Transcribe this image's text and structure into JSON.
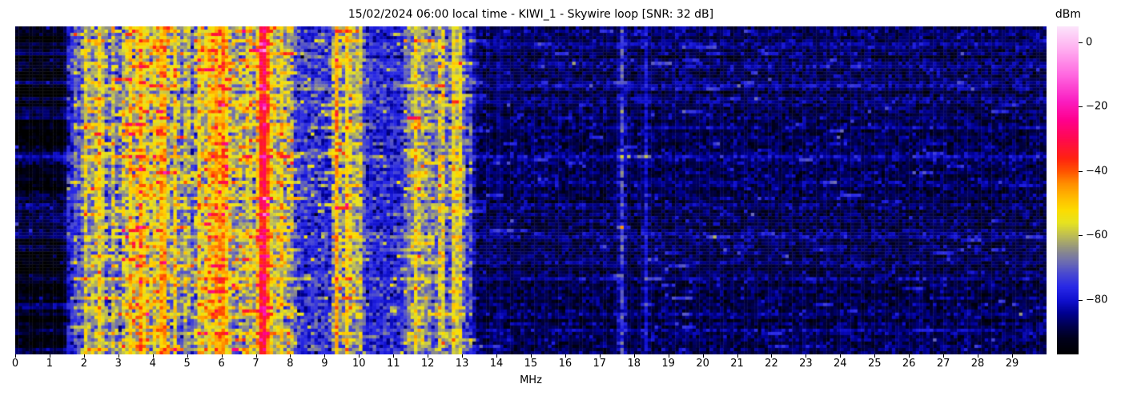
{
  "chart_data": {
    "type": "heatmap",
    "title": "15/02/2024 06:00 local time - KIWI_1 - Skywire loop [SNR: 32 dB]",
    "xlabel": "MHz",
    "x_range": [
      0,
      30
    ],
    "x_ticks": [
      0,
      1,
      2,
      3,
      4,
      5,
      6,
      7,
      8,
      9,
      10,
      11,
      12,
      13,
      14,
      15,
      16,
      17,
      18,
      19,
      20,
      21,
      22,
      23,
      24,
      25,
      26,
      27,
      28,
      29
    ],
    "x_tick_labels": [
      "0",
      "1",
      "2",
      "3",
      "4",
      "5",
      "6",
      "7",
      "8",
      "9",
      "10",
      "11",
      "12",
      "13",
      "14",
      "15",
      "16",
      "17",
      "18",
      "19",
      "20",
      "21",
      "22",
      "23",
      "24",
      "25",
      "26",
      "27",
      "28",
      "29"
    ],
    "y_axis_labels_shown": false,
    "colorbar": {
      "label": "dBm",
      "tick_values": [
        0,
        -20,
        -40,
        -60,
        -80
      ],
      "tick_labels": [
        "0",
        "−20",
        "−40",
        "−60",
        "−80"
      ],
      "value_range": [
        -97,
        5
      ],
      "colormap_stops": [
        [
          0.0,
          "#000000"
        ],
        [
          0.05,
          "#00001c"
        ],
        [
          0.088,
          "#00004e"
        ],
        [
          0.127,
          "#000090"
        ],
        [
          0.167,
          "#1010cf"
        ],
        [
          0.206,
          "#2828e6"
        ],
        [
          0.245,
          "#4747d2"
        ],
        [
          0.284,
          "#6e6eb0"
        ],
        [
          0.324,
          "#929282"
        ],
        [
          0.363,
          "#bdbd55"
        ],
        [
          0.402,
          "#e6e320"
        ],
        [
          0.441,
          "#fcdc00"
        ],
        [
          0.48,
          "#ffba00"
        ],
        [
          0.52,
          "#ff9000"
        ],
        [
          0.559,
          "#ff5300"
        ],
        [
          0.598,
          "#ff2310"
        ],
        [
          0.657,
          "#ff0a4e"
        ],
        [
          0.716,
          "#ff008e"
        ],
        [
          0.775,
          "#fa1fc2"
        ],
        [
          0.853,
          "#ff68e0"
        ],
        [
          0.931,
          "#ffaef0"
        ],
        [
          1.0,
          "#fce4fb"
        ]
      ]
    },
    "grid": {
      "cols": 300,
      "rows": 102
    },
    "seed": 12345,
    "burst_count": 900,
    "noise_bands": [
      [
        0.0,
        1.55,
        -93,
        2.5,
        0.004
      ],
      [
        1.55,
        1.95,
        -80,
        4,
        0.03
      ],
      [
        1.95,
        2.28,
        -76,
        5,
        0.05
      ],
      [
        2.28,
        2.62,
        -65,
        6,
        0.08
      ],
      [
        2.62,
        3.12,
        -73,
        6,
        0.06
      ],
      [
        3.12,
        3.55,
        -64,
        7,
        0.08
      ],
      [
        3.55,
        3.95,
        -61,
        7,
        0.08
      ],
      [
        3.95,
        4.45,
        -67,
        7,
        0.07
      ],
      [
        4.45,
        5.3,
        -73,
        6,
        0.06
      ],
      [
        5.3,
        6.35,
        -61,
        6.5,
        0.08
      ],
      [
        6.35,
        7.08,
        -65,
        6.5,
        0.07
      ],
      [
        7.08,
        8.15,
        -63,
        7,
        0.08
      ],
      [
        8.15,
        9.25,
        -77,
        5,
        0.04
      ],
      [
        9.25,
        10.05,
        -73,
        6,
        0.05
      ],
      [
        10.05,
        11.35,
        -78,
        4.5,
        0.035
      ],
      [
        11.35,
        12.2,
        -71,
        6,
        0.05
      ],
      [
        12.2,
        13.35,
        -78,
        5,
        0.04
      ],
      [
        13.35,
        30.01,
        -88,
        3.2,
        0.006
      ]
    ],
    "carriers": [
      [
        1.75,
        0.04,
        -71,
        9
      ],
      [
        1.87,
        0.04,
        -73,
        9
      ],
      [
        2.02,
        0.05,
        -58,
        7
      ],
      [
        2.22,
        0.04,
        -63,
        10
      ],
      [
        2.47,
        0.1,
        -55,
        5
      ],
      [
        2.88,
        0.05,
        -61,
        9
      ],
      [
        3.32,
        0.05,
        -52,
        10
      ],
      [
        3.62,
        0.04,
        -46,
        6
      ],
      [
        3.78,
        0.05,
        -54,
        6
      ],
      [
        4.02,
        0.04,
        -57,
        8
      ],
      [
        4.3,
        0.05,
        -45,
        6
      ],
      [
        4.65,
        0.04,
        -55,
        8
      ],
      [
        5.0,
        0.04,
        -58,
        8
      ],
      [
        5.38,
        0.04,
        -54,
        7
      ],
      [
        5.62,
        0.04,
        -52,
        7
      ],
      [
        5.87,
        0.05,
        -47,
        6
      ],
      [
        6.02,
        0.05,
        -44,
        6
      ],
      [
        6.18,
        0.04,
        -50,
        7
      ],
      [
        6.8,
        0.04,
        -55,
        8
      ],
      [
        7.21,
        0.05,
        -29,
        4
      ],
      [
        7.35,
        0.05,
        -44,
        6
      ],
      [
        7.49,
        0.04,
        -53,
        8
      ],
      [
        7.75,
        0.04,
        -56,
        8
      ],
      [
        8.0,
        0.04,
        -58,
        8
      ],
      [
        9.33,
        0.05,
        -47,
        6
      ],
      [
        9.66,
        0.05,
        -53,
        7
      ],
      [
        9.9,
        0.04,
        -57,
        8
      ],
      [
        10.07,
        0.04,
        -61,
        10
      ],
      [
        11.42,
        0.09,
        -67,
        6
      ],
      [
        11.65,
        0.05,
        -57,
        8
      ],
      [
        11.85,
        0.05,
        -63,
        8
      ],
      [
        12.08,
        0.05,
        -64,
        8
      ],
      [
        12.4,
        0.04,
        -53,
        13
      ],
      [
        12.78,
        0.04,
        -54,
        7
      ],
      [
        12.97,
        0.04,
        -57,
        8
      ],
      [
        13.25,
        0.04,
        -73,
        8
      ],
      [
        14.1,
        0.05,
        -81,
        4
      ],
      [
        17.65,
        0.05,
        -74,
        9
      ],
      [
        18.35,
        0.04,
        -80,
        4
      ]
    ],
    "row_events": [
      [
        0.05,
        4
      ],
      [
        0.105,
        3
      ],
      [
        0.176,
        4.5
      ],
      [
        0.224,
        3
      ],
      [
        0.305,
        3
      ],
      [
        0.388,
        7
      ],
      [
        0.47,
        3
      ],
      [
        0.545,
        2.5
      ],
      [
        0.64,
        4.5
      ],
      [
        0.715,
        3
      ],
      [
        0.76,
        4
      ],
      [
        0.87,
        3.5
      ],
      [
        0.92,
        4
      ]
    ]
  },
  "layout_colors": {
    "background": "#ffffff",
    "text": "#000000"
  }
}
